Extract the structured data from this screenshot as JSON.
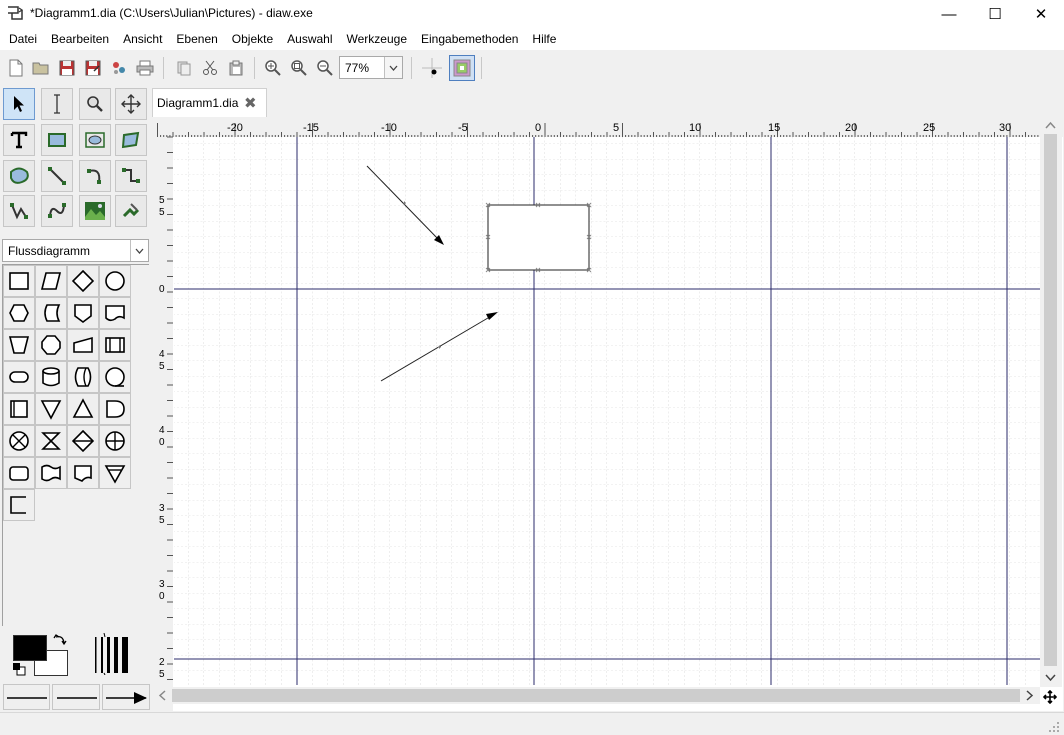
{
  "window": {
    "title": "*Diagramm1.dia (C:\\Users\\Julian\\Pictures) - diaw.exe",
    "minimize_glyph": "—",
    "maximize_glyph": "☐",
    "close_glyph": "✕"
  },
  "menu": [
    "Datei",
    "Bearbeiten",
    "Ansicht",
    "Ebenen",
    "Objekte",
    "Auswahl",
    "Werkzeuge",
    "Eingabemethoden",
    "Hilfe"
  ],
  "toolbar": {
    "zoom_value": "77%",
    "icons": [
      "new-file-icon",
      "open-folder-icon",
      "save-icon",
      "save-as-icon",
      "export-icon",
      "print-icon",
      "copy-icon",
      "cut-icon",
      "paste-icon",
      "zoom-in-icon",
      "zoom-fit-icon",
      "zoom-out-icon",
      "snap-to-grid-icon",
      "snap-to-objects-icon"
    ]
  },
  "toolbox": {
    "tools": [
      "pointer-tool",
      "text-edit-tool",
      "magnify-tool",
      "scroll-tool",
      "text-tool",
      "box-tool",
      "ellipse-tool",
      "polygon-tool",
      "beziergon-tool",
      "line-tool",
      "arc-tool",
      "zigzag-line-tool",
      "polyline-tool",
      "bezier-line-tool",
      "image-tool",
      "outline-tool"
    ],
    "sheet_name": "Flussdiagramm",
    "shapes": [
      "process",
      "data-io",
      "decision",
      "connector",
      "preparation",
      "stored-data",
      "offpage-connector",
      "document",
      "manual-operation",
      "terminal-hexagon",
      "card",
      "predefined-process",
      "terminal",
      "direct-storage",
      "delay-rounded",
      "sequential-storage",
      "internal-storage",
      "extract",
      "merge",
      "delay",
      "summing-junction",
      "collate",
      "sort",
      "or-junction",
      "display",
      "punched-tape",
      "multi-document",
      "merge-down",
      "annotation"
    ],
    "line_widths": [
      "thin",
      "medium",
      "thick",
      "heavy"
    ],
    "line_styles": [
      "solid-line",
      "solid-line-2",
      "arrow-line"
    ]
  },
  "document_tab": {
    "label": "Diagramm1.dia",
    "close_glyph": "✖"
  },
  "ruler": {
    "h_labels": [
      "-20",
      "-15",
      "-10",
      "-5",
      "0",
      "5",
      "10",
      "15",
      "20",
      "25",
      "30"
    ],
    "v_labels": [
      "5",
      "5",
      "0",
      "4",
      "5",
      "4",
      "0",
      "3",
      "5",
      "3",
      "0",
      "2",
      "5"
    ]
  },
  "status": {
    "text": ""
  }
}
